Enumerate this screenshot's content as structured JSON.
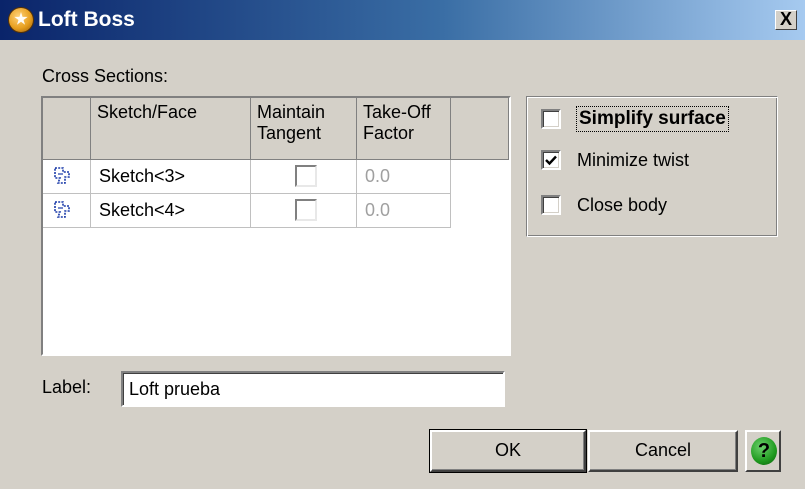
{
  "window": {
    "title": "Loft Boss",
    "close_symbol": "X",
    "app_icon": "loft-boss-icon"
  },
  "cross_sections": {
    "label": "Cross Sections:",
    "columns": [
      {
        "header": [
          "",
          ""
        ]
      },
      {
        "header": [
          "Sketch/Face",
          ""
        ]
      },
      {
        "header": [
          "Maintain",
          "Tangent"
        ]
      },
      {
        "header": [
          "Take-Off",
          "Factor"
        ]
      },
      {
        "header": [
          "",
          ""
        ]
      }
    ],
    "rows": [
      {
        "icon": "sketch-icon",
        "name": "Sketch<3>",
        "maintain_tangent": false,
        "takeoff_factor": "0.0"
      },
      {
        "icon": "sketch-icon",
        "name": "Sketch<4>",
        "maintain_tangent": false,
        "takeoff_factor": "0.0"
      }
    ]
  },
  "options": {
    "simplify_surface": {
      "label": "Simplify surface",
      "checked": false
    },
    "minimize_twist": {
      "label": "Minimize twist",
      "checked": true
    },
    "close_body": {
      "label": "Close body",
      "checked": false
    }
  },
  "label_field": {
    "label": "Label:",
    "value": "Loft prueba"
  },
  "buttons": {
    "ok": "OK",
    "cancel": "Cancel",
    "help": "?"
  }
}
